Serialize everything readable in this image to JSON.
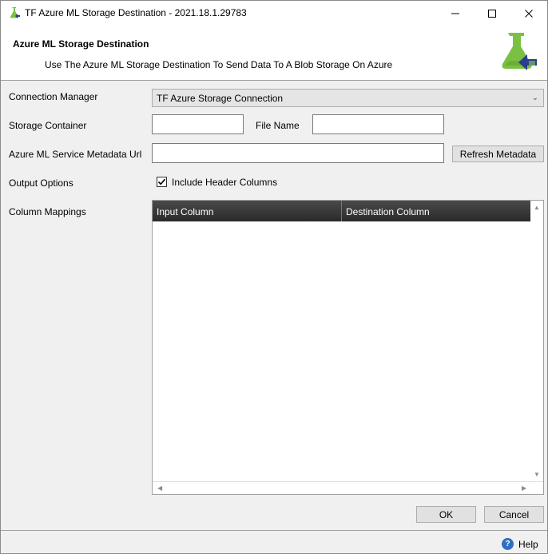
{
  "window": {
    "title": "TF Azure ML Storage Destination - 2021.18.1.29783",
    "minimize_glyph": "—",
    "maximize_glyph": "☐",
    "close_glyph": "✕"
  },
  "header": {
    "title": "Azure ML Storage Destination",
    "subtitle": "Use The Azure ML Storage Destination To Send Data To A Blob Storage On Azure",
    "logo_icon": "flask-arrow-icon",
    "accent_color": "#7ac143",
    "arrow_color": "#2b3d8f"
  },
  "form": {
    "connection_manager_label": "Connection Manager",
    "connection_manager_value": "TF Azure Storage Connection",
    "storage_container_label": "Storage Container",
    "storage_container_value": "",
    "file_name_label": "File Name",
    "file_name_value": "",
    "metadata_url_label": "Azure ML Service Metadata Url",
    "metadata_url_value": "",
    "refresh_metadata_label": "Refresh Metadata",
    "output_options_label": "Output Options",
    "include_header_label": "Include Header Columns",
    "include_header_checked": true,
    "column_mappings_label": "Column Mappings"
  },
  "grid": {
    "columns": [
      "Input Column",
      "Destination Column"
    ],
    "rows": []
  },
  "buttons": {
    "ok": "OK",
    "cancel": "Cancel"
  },
  "footer": {
    "help_label": "Help",
    "help_glyph": "?"
  }
}
